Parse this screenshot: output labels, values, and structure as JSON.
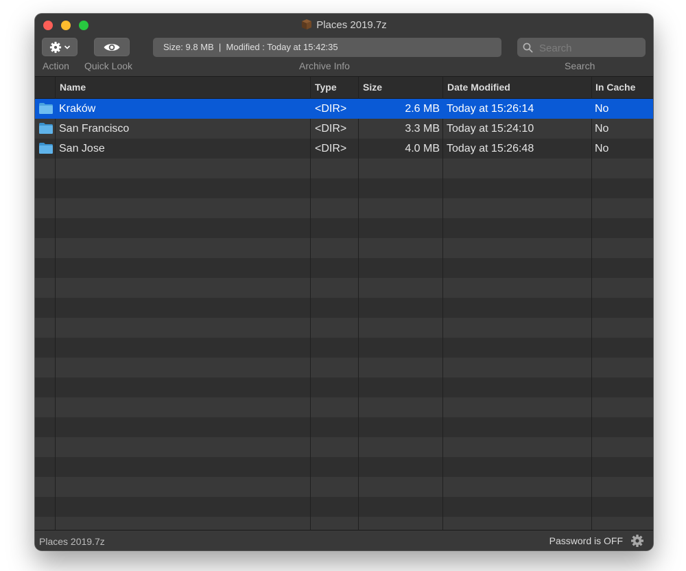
{
  "window": {
    "title": "Places 2019.7z"
  },
  "toolbar": {
    "action_label": "Action",
    "quicklook_label": "Quick Look",
    "archive_info_label": "Archive Info",
    "archive_info": "Size: 9.8 MB  |  Modified : Today at 15:42:35",
    "search_label": "Search",
    "search_placeholder": "Search"
  },
  "table": {
    "columns": [
      "Name",
      "Type",
      "Size",
      "Date Modified",
      "In Cache"
    ],
    "rows": [
      {
        "name": "Kraków",
        "type": "<DIR>",
        "size": "2.6 MB",
        "date": "Today at 15:26:14",
        "cache": "No"
      },
      {
        "name": "San Francisco",
        "type": "<DIR>",
        "size": "3.3 MB",
        "date": "Today at 15:24:10",
        "cache": "No"
      },
      {
        "name": "San Jose",
        "type": "<DIR>",
        "size": "4.0 MB",
        "date": "Today at 15:26:48",
        "cache": "No"
      }
    ],
    "selected_row": 0
  },
  "statusbar": {
    "archive_name": "Places 2019.7z",
    "password_status": "Password is OFF"
  },
  "colors": {
    "selection": "#0a5ad6",
    "folder": "#4aa3df",
    "close": "#fe5f57",
    "minimize": "#febc2e",
    "maximize": "#28c840"
  },
  "icons": [
    "gear-icon",
    "chevron-down-icon",
    "eye-icon",
    "archive-box-icon",
    "search-icon",
    "folder-icon"
  ]
}
